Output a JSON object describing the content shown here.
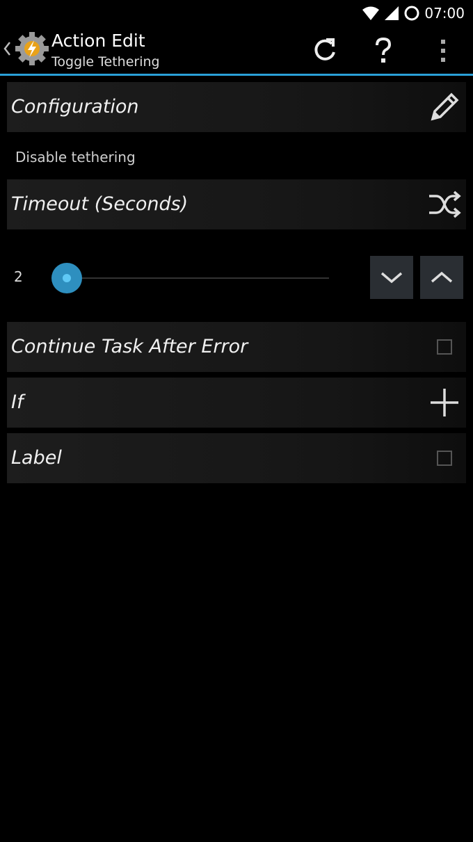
{
  "status": {
    "time": "07:00"
  },
  "actionbar": {
    "title": "Action Edit",
    "subtitle": "Toggle Tethering"
  },
  "configuration": {
    "label": "Configuration",
    "value": "Disable tethering"
  },
  "timeout": {
    "label": "Timeout (Seconds)",
    "value": "2"
  },
  "continue_after_error": {
    "label": "Continue Task After Error",
    "checked": false
  },
  "if_row": {
    "label": "If"
  },
  "label_row": {
    "label": "Label",
    "checked": false
  },
  "colors": {
    "accent": "#2aa0d8",
    "slider": "#2e8fbf"
  }
}
